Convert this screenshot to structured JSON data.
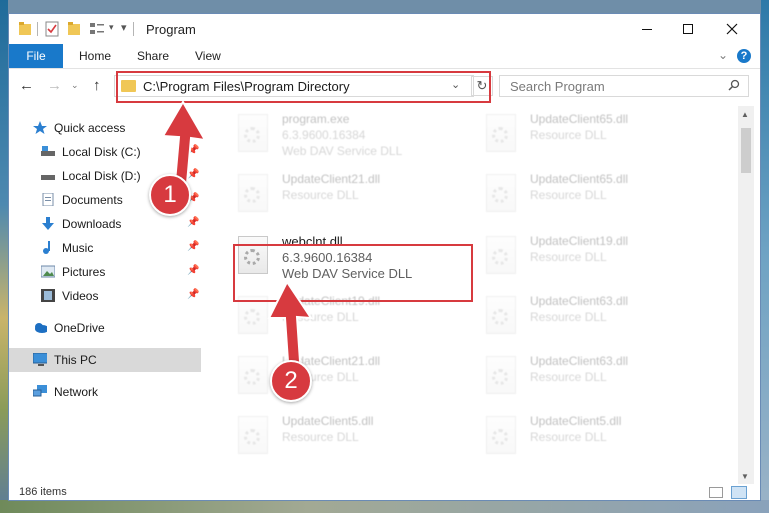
{
  "window": {
    "title": "Program",
    "controls": [
      "minimize-icon",
      "maximize-icon",
      "close-icon"
    ]
  },
  "ribbon": {
    "file": "File",
    "tabs": [
      "Home",
      "Share",
      "View"
    ],
    "help": "?"
  },
  "nav": {
    "address": "C:\\Program Files\\Program Directory",
    "search_placeholder": "Search Program"
  },
  "sidebar": {
    "items": [
      {
        "label": "Quick access",
        "icon": "star-icon",
        "pinned": false
      },
      {
        "label": "Local Disk (C:)",
        "icon": "drive-icon",
        "pinned": true
      },
      {
        "label": "Local Disk (D:)",
        "icon": "drive-icon",
        "pinned": true
      },
      {
        "label": "Documents",
        "icon": "documents-icon",
        "pinned": true
      },
      {
        "label": "Downloads",
        "icon": "download-icon",
        "pinned": true
      },
      {
        "label": "Music",
        "icon": "music-icon",
        "pinned": true
      },
      {
        "label": "Pictures",
        "icon": "pictures-icon",
        "pinned": true
      },
      {
        "label": "Videos",
        "icon": "videos-icon",
        "pinned": true
      },
      {
        "label": "OneDrive",
        "icon": "cloud-icon",
        "pinned": false
      },
      {
        "label": "This PC",
        "icon": "computer-icon",
        "pinned": false,
        "selected": true
      },
      {
        "label": "Network",
        "icon": "network-icon",
        "pinned": false
      }
    ]
  },
  "files": [
    {
      "name": "program.exe",
      "version": "6.3.9600.16384",
      "description": "Web DAV Service DLL"
    },
    {
      "name": "UpdateClient65.dll",
      "version": "",
      "description": "Resource DLL"
    },
    {
      "name": "UpdateClient21.dll",
      "version": "",
      "description": "Resource DLL"
    },
    {
      "name": "UpdateClient65.dll",
      "version": "",
      "description": "Resource DLL"
    },
    {
      "name": "webclnt.dll",
      "version": "6.3.9600.16384",
      "description": "Web DAV Service DLL"
    },
    {
      "name": "UpdateClient19.dll",
      "version": "",
      "description": "Resource DLL"
    },
    {
      "name": "UpdateClient19.dll",
      "version": "",
      "description": "Resource DLL"
    },
    {
      "name": "UpdateClient63.dll",
      "version": "",
      "description": "Resource DLL"
    },
    {
      "name": "UpdateClient21.dll",
      "version": "",
      "description": "Resource DLL"
    },
    {
      "name": "UpdateClient63.dll",
      "version": "",
      "description": "Resource DLL"
    },
    {
      "name": "UpdateClient5.dll",
      "version": "",
      "description": "Resource DLL"
    },
    {
      "name": "UpdateClient5.dll",
      "version": "",
      "description": "Resource DLL"
    }
  ],
  "status": {
    "count": "186 items"
  },
  "steps": [
    "1",
    "2"
  ],
  "colors": {
    "accent": "#1979ca",
    "callout": "#d73a3f",
    "selected": "#d9d9d9"
  }
}
